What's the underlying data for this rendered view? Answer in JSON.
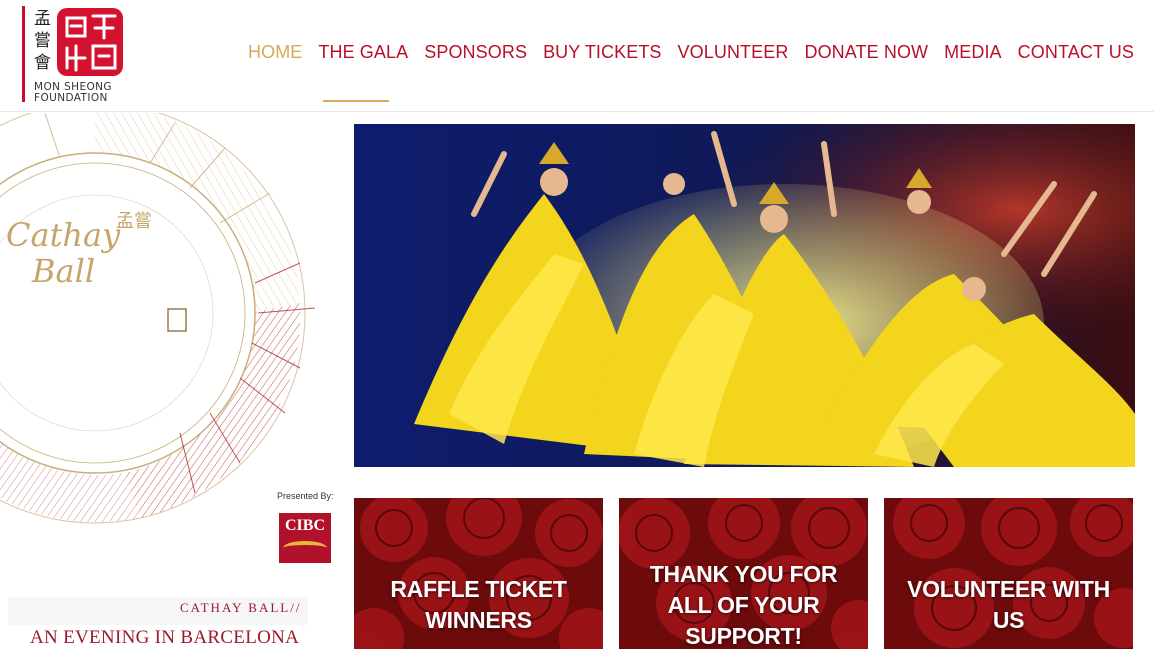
{
  "logo": {
    "chinese_chars": "孟嘗會",
    "name_line1": "MON SHEONG",
    "name_line2": "FOUNDATION",
    "brand_red": "#d3122f"
  },
  "nav": {
    "items": [
      {
        "label": "HOME",
        "active": true
      },
      {
        "label": "THE GALA",
        "active": false
      },
      {
        "label": "SPONSORS",
        "active": false
      },
      {
        "label": "BUY TICKETS",
        "active": false
      },
      {
        "label": "VOLUNTEER",
        "active": false
      },
      {
        "label": "DONATE NOW",
        "active": false
      },
      {
        "label": "MEDIA",
        "active": false
      },
      {
        "label": "CONTACT US",
        "active": false
      }
    ],
    "active_color": "#d6a95b",
    "color": "#b8102a"
  },
  "event_logo": {
    "line1": "Cathay",
    "line2": "Ball",
    "chinese": "孟嘗"
  },
  "sponsor": {
    "presented_by": "Presented By:",
    "name": "CIBC"
  },
  "tagline": {
    "line1": "CATHAY BALL//",
    "line2": "AN EVENING IN BARCELONA"
  },
  "tiles": [
    {
      "line1": "RAFFLE TICKET",
      "line2": "WINNERS",
      "line3": ""
    },
    {
      "line1": "THANK YOU FOR",
      "line2": "ALL OF YOUR",
      "line3": "SUPPORT!"
    },
    {
      "line1": "VOLUNTEER WITH",
      "line2": "US",
      "line3": ""
    }
  ]
}
